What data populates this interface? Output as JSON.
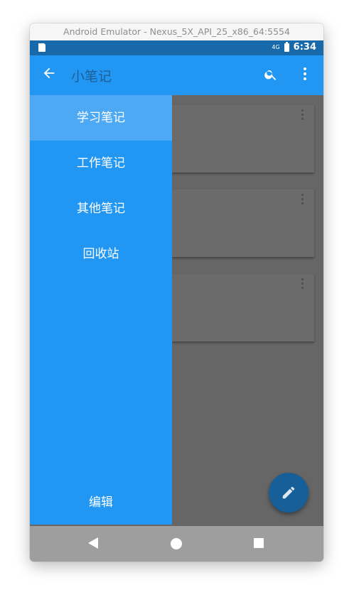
{
  "window": {
    "title": "Android Emulator - Nexus_5X_API_25_x86_64:5554"
  },
  "statusbar": {
    "signal": "4G",
    "time": "6:34"
  },
  "appbar": {
    "title": "小笔记"
  },
  "drawer": {
    "items": [
      {
        "label": "学习笔记",
        "active": true
      },
      {
        "label": "工作笔记",
        "active": false
      },
      {
        "label": "其他笔记",
        "active": false
      },
      {
        "label": "回收站",
        "active": false
      }
    ],
    "edit_label": "编辑"
  },
  "notes": [
    {},
    {},
    {}
  ],
  "colors": {
    "primary": "#2196f3",
    "primary_dark": "#1769aa",
    "drawer_active": "#4ea9f5",
    "scrim": "#666666",
    "fab": "#175f99",
    "navbar": "#9e9e9e"
  },
  "icons": {
    "back": "arrow-left-icon",
    "search": "search-icon",
    "more": "more-vert-icon",
    "fab": "edit-pencil-icon",
    "nav_back": "nav-back-icon",
    "nav_home": "nav-home-icon",
    "nav_recents": "nav-recents-icon"
  }
}
